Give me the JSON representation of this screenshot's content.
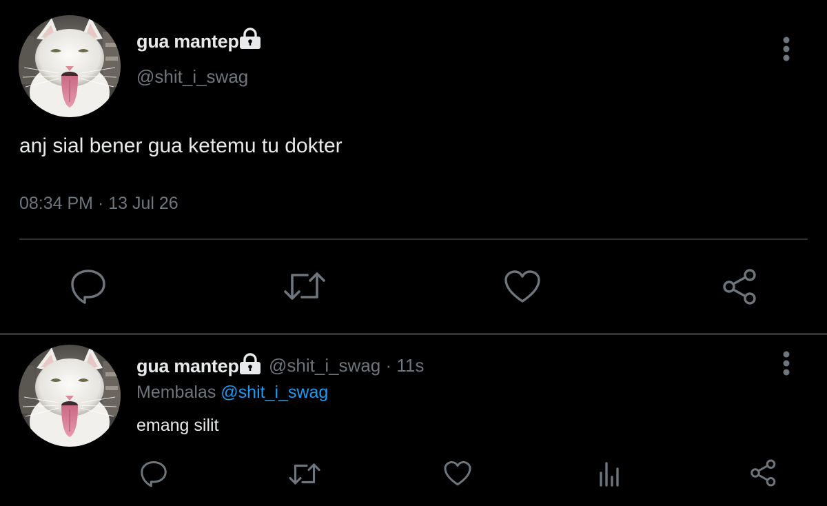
{
  "main_tweet": {
    "author_name": "gua mantep",
    "handle": "@shit_i_swag",
    "text": "anj sial bener gua ketemu tu dokter",
    "timestamp": "08:34 PM · 13 Jul 26",
    "icons": {
      "avatar": "cat-avatar",
      "protected": "lock-icon",
      "menu": "more-vertical-icon",
      "actions": [
        "reply-icon",
        "retweet-icon",
        "like-icon",
        "share-icon"
      ]
    }
  },
  "reply": {
    "author_name": "gua mantep",
    "handle": "@shit_i_swag",
    "separator": " · ",
    "time_ago": "11s",
    "replying_to_label": "Membalas",
    "replying_to_handle": "@shit_i_swag",
    "text": "emang silit",
    "icons": {
      "avatar": "cat-avatar",
      "protected": "lock-icon",
      "menu": "more-vertical-icon",
      "actions": [
        "reply-icon",
        "retweet-icon",
        "like-icon",
        "analytics-icon",
        "share-icon"
      ]
    }
  },
  "colors": {
    "background": "#000000",
    "primary_text": "#e7e9ea",
    "secondary_text": "#6e767d",
    "link": "#1d9bf0",
    "divider": "#2f3336"
  }
}
